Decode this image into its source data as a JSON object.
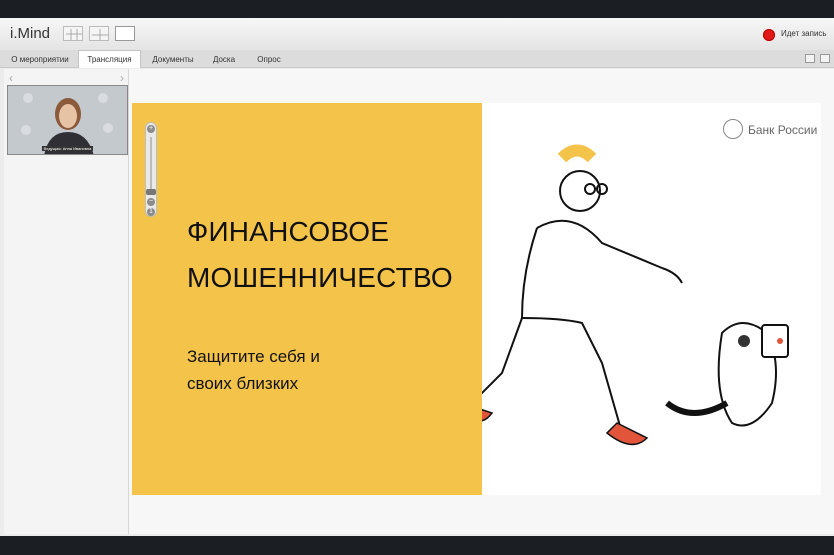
{
  "app": {
    "brand": "i.Mind",
    "record_label": "Идет запись"
  },
  "tabs": [
    {
      "label": "О мероприятии"
    },
    {
      "label": "Трансляция"
    },
    {
      "label": "Документы"
    },
    {
      "label": "Доска"
    },
    {
      "label": "Опрос"
    }
  ],
  "video": {
    "caption": "Ведущая: Анна Ивановна"
  },
  "slide": {
    "title_line1": "ФИНАНСОВОЕ",
    "title_line2": "МОШЕННИЧЕСТВО",
    "subtitle_line1": "Защитите себя и",
    "subtitle_line2": "своих близких",
    "logo_text": "Банк России"
  },
  "colors": {
    "slide_yellow": "#f4c44a",
    "record_red": "#e01818"
  }
}
